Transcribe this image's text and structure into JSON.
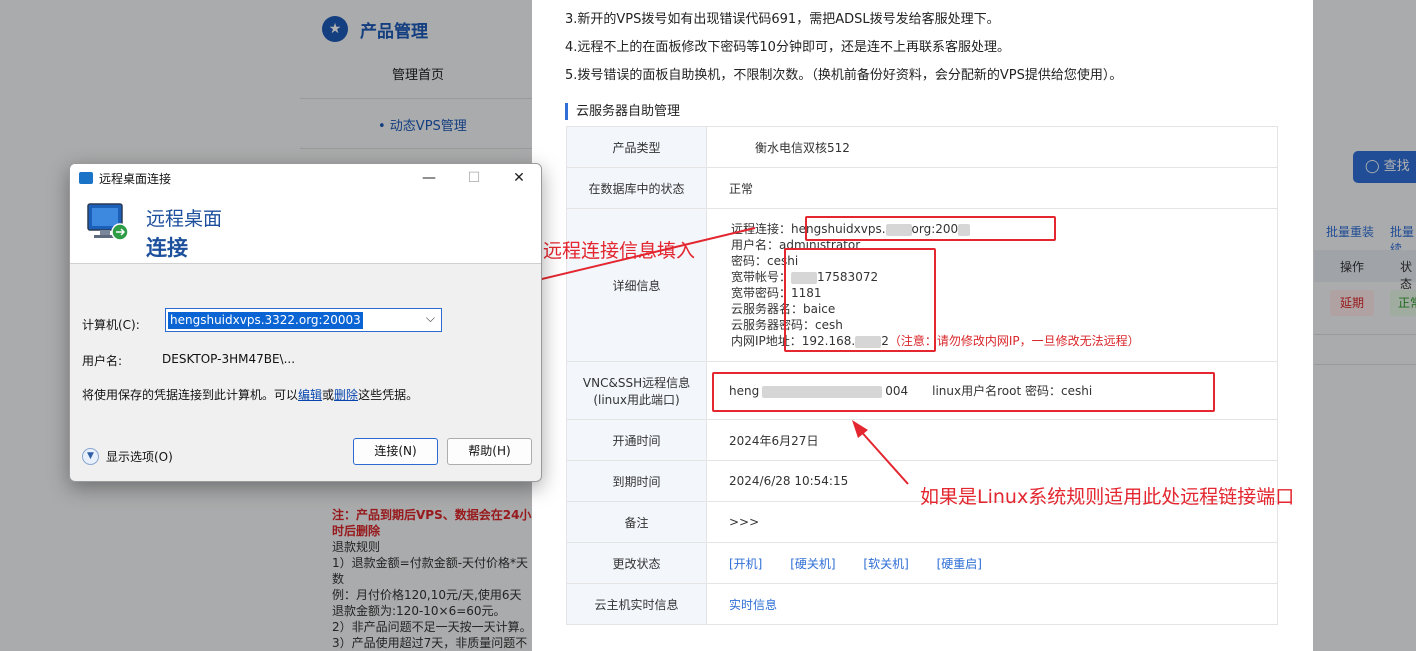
{
  "background": {
    "sidebar_title": "产品管理",
    "menu_home": "管理首页",
    "menu_vps": "• 动态VPS管理",
    "search_button": "◯ 查找",
    "bulk_reinstall": "批量重装",
    "bulk_other": "批量续",
    "col_action": "操作",
    "col_status": "状态",
    "btn_renew": "延期",
    "btn_status": "正常",
    "note_red": "注：产品到期后VPS、数据会在24小时后删除",
    "note_lines": [
      "退款规则",
      "1）退款金额=付款金额-天付价格*天数",
      "例：月付价格120,10元/天,使用6天退款金额为:120-10×6=60元。",
      "2）非产品问题不足一天按一天计算。",
      "3）产品使用超过7天，非质量问题不"
    ]
  },
  "tips": [
    "3.新开的VPS拨号如有出现错误代码691，需把ADSL拨号发给客服处理下。",
    "4.远程不上的在面板修改下密码等10分钟即可，还是连不上再联系客服处理。",
    "5.拨号错误的面板自助换机，不限制次数。（换机前备份好资料，会分配新的VPS提供给您使用）。"
  ],
  "section_title": "云服务器自助管理",
  "table": {
    "product_type": {
      "label": "产品类型",
      "value": "衡水电信双核512"
    },
    "db_status": {
      "label": "在数据库中的状态",
      "value": "正常"
    },
    "details": {
      "label": "详细信息",
      "remote": "远程连接：hengshuidxvps.",
      "remote_suffix": "org:200",
      "username": "用户名：administrator",
      "password": "密码：ceshi",
      "broadband_account": "宽带帐号：",
      "broadband_account_suffix": "17583072",
      "broadband_password": "宽带密码：1181",
      "cloud_user": "云服务器名：baice",
      "cloud_password": "云服务器密码：cesh",
      "intranet": "内网IP地址：192.168.",
      "intranet_suffix": "2",
      "intranet_warning": "（注意：请勿修改内网IP，一旦修改无法远程）"
    },
    "vnc": {
      "label_line1": "VNC&SSH远程信息",
      "label_line2": "(linux用此端口)",
      "value_prefix": "heng",
      "value_mid": "004",
      "value_suffix": "linux用户名root 密码：ceshi"
    },
    "open_time": {
      "label": "开通时间",
      "value": "2024年6月27日"
    },
    "expire_time": {
      "label": "到期时间",
      "value": "2024/6/28 10:54:15"
    },
    "remark": {
      "label": "备注",
      "value": ">>>"
    },
    "change_status": {
      "label": "更改状态",
      "links": [
        "[开机]",
        "[硬关机]",
        "[软关机]",
        "[硬重启]"
      ]
    },
    "realtime": {
      "label": "云主机实时信息",
      "value": "实时信息"
    }
  },
  "annotations": {
    "fill_in": "将远程连接信息填入",
    "linux_port": "如果是Linux系统规则适用此处远程链接端口"
  },
  "rdp_dialog": {
    "title": "远程桌面连接",
    "minimize": "—",
    "maximize": "☐",
    "close": "✕",
    "banner_line1": "远程桌面",
    "banner_line2": "连接",
    "computer_label": "计算机(C):",
    "computer_value": "hengshuidxvps.3322.org:20003",
    "username_label": "用户名:",
    "username_value": "DESKTOP-3HM47BE\\...",
    "cred_text_1": "将使用保存的凭据连接到此计算机。可以",
    "cred_edit": "编辑",
    "cred_or": "或",
    "cred_delete": "删除",
    "cred_text_2": "这些凭据。",
    "show_options": "显示选项(O)",
    "connect_button": "连接(N)",
    "help_button": "帮助(H)"
  }
}
